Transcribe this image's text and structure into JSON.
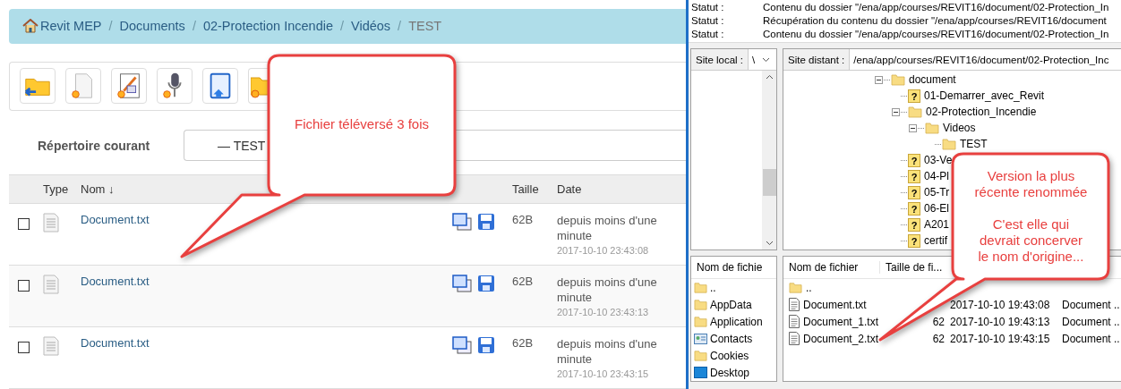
{
  "breadcrumb_separator": "/",
  "breadcrumb": [
    {
      "label": "Revit MEP",
      "kind": "home",
      "current": false
    },
    {
      "label": "Documents",
      "kind": "link",
      "current": false
    },
    {
      "label": "02-Protection Incendie",
      "kind": "link",
      "current": false
    },
    {
      "label": "Vidéos",
      "kind": "link",
      "current": false
    },
    {
      "label": "TEST",
      "kind": "link",
      "current": true
    }
  ],
  "toolbar": [
    {
      "kind": "folder-back"
    },
    {
      "kind": "new-file"
    },
    {
      "kind": "edit"
    },
    {
      "kind": "microphone"
    },
    {
      "kind": "upload"
    },
    {
      "kind": "new-folder"
    }
  ],
  "current_directory": {
    "label": "Répertoire courant",
    "value": "— TEST"
  },
  "table": {
    "columns": [
      "Type",
      "Nom ↓",
      "Taille",
      "Date"
    ],
    "rows": [
      {
        "checked": false,
        "name": "Document.txt",
        "size": "62B",
        "relative": "depuis moins d'une minute",
        "date": "2017-10-10 23:43:08"
      },
      {
        "checked": false,
        "name": "Document.txt",
        "size": "62B",
        "relative": "depuis moins d'une minute",
        "date": "2017-10-10 23:43:13"
      },
      {
        "checked": false,
        "name": "Document.txt",
        "size": "62B",
        "relative": "depuis moins d'une minute",
        "date": "2017-10-10 23:43:15"
      }
    ]
  },
  "ftp": {
    "status": [
      {
        "label": "Statut :",
        "message": "Contenu du dossier \"/ena/app/courses/REVIT16/document/02-Protection_In"
      },
      {
        "label": "Statut :",
        "message": "Récupération du contenu du dossier \"/ena/app/courses/REVIT16/document"
      },
      {
        "label": "Statut :",
        "message": "Contenu du dossier \"/ena/app/courses/REVIT16/document/02-Protection_In"
      }
    ],
    "unknown_mark": "?",
    "local_site": {
      "label": "Site local :",
      "value": "\\"
    },
    "remote_site": {
      "label": "Site distant :",
      "value": "/ena/app/courses/REVIT16/document/02-Protection_Inc"
    },
    "remote_tree": [
      {
        "label": "document",
        "kind": "folder",
        "expanded": true,
        "children": [
          {
            "label": "01-Demarrer_avec_Revit",
            "kind": "unknown"
          },
          {
            "label": "02-Protection_Incendie",
            "kind": "folder",
            "expanded": true,
            "children": [
              {
                "label": "Videos",
                "kind": "folder",
                "expanded": true,
                "children": [
                  {
                    "label": "TEST",
                    "kind": "folder"
                  }
                ]
              }
            ]
          },
          {
            "label": "03-Ve",
            "kind": "unknown"
          },
          {
            "label": "04-Pl",
            "kind": "unknown"
          },
          {
            "label": "05-Tr",
            "kind": "unknown"
          },
          {
            "label": "06-El",
            "kind": "unknown"
          },
          {
            "label": "A201",
            "kind": "unknown"
          },
          {
            "label": "certif",
            "kind": "unknown"
          }
        ]
      }
    ],
    "local_files": {
      "column": "Nom de fichie",
      "items": [
        {
          "name": "..",
          "kind": "folder"
        },
        {
          "name": "AppData",
          "kind": "folder"
        },
        {
          "name": "Application",
          "kind": "folder"
        },
        {
          "name": "Contacts",
          "kind": "contacts"
        },
        {
          "name": "Cookies",
          "kind": "folder"
        },
        {
          "name": "Desktop",
          "kind": "desktop"
        }
      ]
    },
    "remote_files": {
      "columns": [
        "Nom de fichier",
        "Taille de fi..."
      ],
      "rows": [
        {
          "name": "..",
          "kind": "folder"
        },
        {
          "name": "Document.txt",
          "kind": "file",
          "modified": "2017-10-10 19:43:08",
          "type": "Document .."
        },
        {
          "name": "Document_1.txt",
          "kind": "file",
          "size": "62",
          "modified": "2017-10-10 19:43:13",
          "type": "Document .."
        },
        {
          "name": "Document_2.txt",
          "kind": "file",
          "size": "62",
          "modified": "2017-10-10 19:43:15",
          "type": "Document .."
        }
      ]
    }
  },
  "callouts": [
    {
      "paragraphs": [
        "Fichier téléversé 3 fois"
      ]
    },
    {
      "paragraphs": [
        "Version la plus récente renommée",
        "C'est elle qui devrait concerver le nom d'origine..."
      ]
    }
  ]
}
